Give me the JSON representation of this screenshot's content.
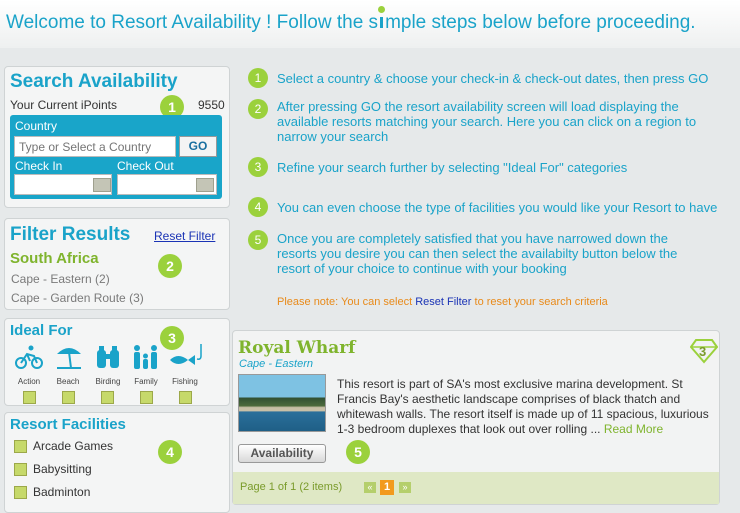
{
  "header": {
    "title_before": "Welcome to Resort Availability ! Follow the s",
    "title_after": "mple steps below before proceeding."
  },
  "search": {
    "heading": "Search Availability",
    "points_label": "Your Current iPoints",
    "points_value": "9550",
    "step": "1",
    "country_label": "Country",
    "country_placeholder": "Type or Select a Country",
    "go_label": "GO",
    "checkin_label": "Check In",
    "checkout_label": "Check Out"
  },
  "filter": {
    "heading": "Filter Results",
    "reset_label": "Reset Filter",
    "country": "South Africa",
    "step": "2",
    "regions": [
      "Cape - Eastern (2)",
      "Cape - Garden Route (3)"
    ]
  },
  "ideal": {
    "heading": "Ideal For",
    "step": "3",
    "items": [
      {
        "label": "Action",
        "icon": "cyclist-icon"
      },
      {
        "label": "Beach",
        "icon": "beach-umbrella-icon"
      },
      {
        "label": "Birding",
        "icon": "binoculars-icon"
      },
      {
        "label": "Family",
        "icon": "family-icon"
      },
      {
        "label": "Fishing",
        "icon": "fish-icon"
      }
    ]
  },
  "facilities": {
    "heading": "Resort Facilities",
    "step": "4",
    "items": [
      "Arcade Games",
      "Babysitting",
      "Badminton"
    ]
  },
  "steps": [
    {
      "num": "1",
      "text": "Select a country & choose your check-in & check-out dates, then press GO"
    },
    {
      "num": "2",
      "text": "After pressing GO the resort availability screen will load displaying the available resorts matching your search. Here you can click on a region to narrow your search"
    },
    {
      "num": "3",
      "text": "Refine your search further by selecting \"Ideal For\" categories"
    },
    {
      "num": "4",
      "text": "You can even choose the type of facilities you would like your Resort to have"
    },
    {
      "num": "5",
      "text": "Once you are completely satisfied that you have narrowed down the resorts you desire you can then select the availabilty button below the resort of your choice to continue with your booking"
    }
  ],
  "note": {
    "before": "Please note: You can select ",
    "link": "Reset Filter",
    "after": " to reset your search criteria"
  },
  "resort": {
    "name": "Royal Wharf",
    "region": "Cape - Eastern",
    "rating": "3",
    "description": "This resort is part of SA's most exclusive marina development. St Francis Bay's aesthetic landscape comprises of black thatch and whitewash walls. The resort itself is made up of 11 spacious, luxurious 1-3 bedroom duplexes that look out over rolling ...",
    "read_more": "Read More",
    "availability_label": "Availability",
    "step": "5"
  },
  "pager": {
    "text": "Page 1 of 1 (2 items)",
    "current": "1",
    "prev": "«",
    "next": "»"
  },
  "colors": {
    "accent": "#1aa3c9",
    "green": "#9bd13c",
    "link": "#1a33b5",
    "note": "#e88a1a",
    "resort": "#7fb42d"
  }
}
